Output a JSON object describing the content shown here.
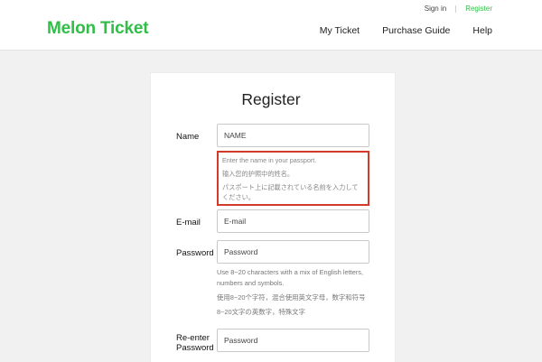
{
  "header": {
    "logo_text": "Melon Ticket",
    "signin_label": "Sign in",
    "register_label": "Register",
    "nav": [
      "My Ticket",
      "Purchase Guide",
      "Help"
    ]
  },
  "form": {
    "title": "Register",
    "name": {
      "label": "Name",
      "placeholder": "NAME",
      "notes": [
        "Enter the name in your passport.",
        "输入您的护照中的姓名。",
        "パスポート上に記載されている名前を入力してください。"
      ]
    },
    "email": {
      "label": "E-mail",
      "placeholder": "E-mail"
    },
    "password": {
      "label": "Password",
      "placeholder": "Password",
      "hints": [
        "Use 8~20 characters with a mix of English letters, numbers and symbols.",
        "使用8~20个字符，混合使用英文字母，数字和符号",
        "8~20文字の英数字，特殊文字"
      ]
    },
    "reenter": {
      "label_line1": "Re-enter",
      "label_line2": "Password",
      "placeholder": "Password"
    }
  },
  "colors": {
    "brand": "#2fbf47",
    "alert_border": "#d43a2a",
    "background": "#f1f1f1"
  }
}
